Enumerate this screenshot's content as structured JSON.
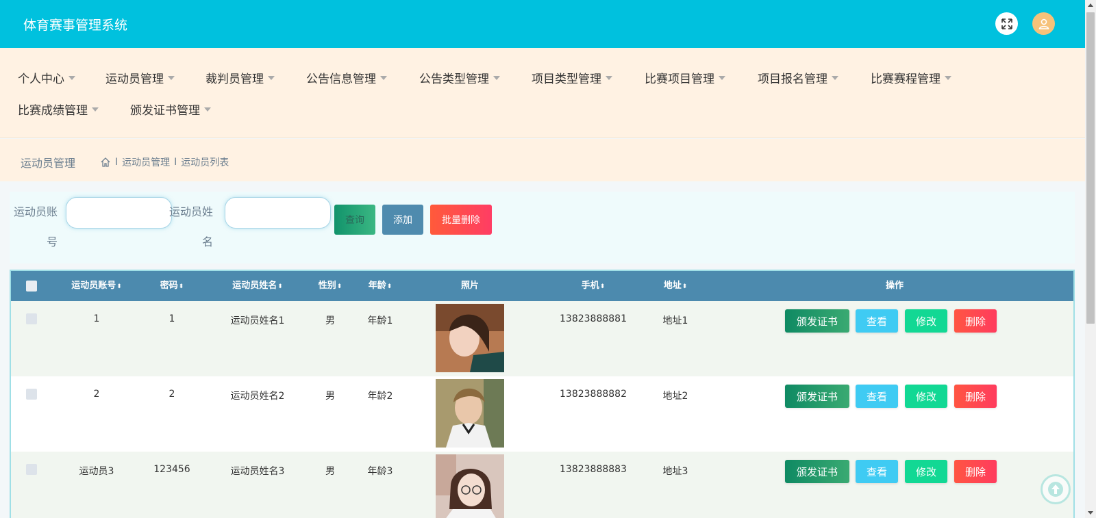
{
  "header": {
    "title": "体育赛事管理系统"
  },
  "nav": {
    "items": [
      {
        "label": "个人中心"
      },
      {
        "label": "运动员管理"
      },
      {
        "label": "裁判员管理"
      },
      {
        "label": "公告信息管理"
      },
      {
        "label": "公告类型管理"
      },
      {
        "label": "项目类型管理"
      },
      {
        "label": "比赛项目管理"
      },
      {
        "label": "项目报名管理"
      },
      {
        "label": "比赛赛程管理"
      },
      {
        "label": "比赛成绩管理"
      },
      {
        "label": "颁发证书管理"
      }
    ]
  },
  "breadcrumb": {
    "title": "运动员管理",
    "sep": "I",
    "path": [
      "运动员管理",
      "运动员列表"
    ]
  },
  "search": {
    "account_label_1": "运动员账",
    "account_label_2": "号",
    "name_label_1": "运动员姓",
    "name_label_2": "名",
    "account_value": "",
    "name_value": "",
    "query_label": "查询",
    "add_label": "添加",
    "batch_delete_label": "批量删除"
  },
  "table": {
    "columns": [
      "运动员账号",
      "密码",
      "运动员姓名",
      "性别",
      "年龄",
      "照片",
      "手机",
      "地址",
      "操作"
    ],
    "sort_glyph": "⬍",
    "actions": {
      "cert": "颁发证书",
      "view": "查看",
      "edit": "修改",
      "delete": "删除"
    },
    "rows": [
      {
        "account": "1",
        "password": "1",
        "name": "运动员姓名1",
        "gender": "男",
        "age": "年龄1",
        "phone": "13823888881",
        "address": "地址1"
      },
      {
        "account": "2",
        "password": "2",
        "name": "运动员姓名2",
        "gender": "男",
        "age": "年龄2",
        "phone": "13823888882",
        "address": "地址2"
      },
      {
        "account": "运动员3",
        "password": "123456",
        "name": "运动员姓名3",
        "gender": "男",
        "age": "年龄3",
        "phone": "13823888883",
        "address": "地址3"
      }
    ]
  },
  "colors": {
    "header_bg": "#00c1de",
    "nav_bg": "#fff2e3",
    "table_header_bg": "#4c8aae"
  }
}
